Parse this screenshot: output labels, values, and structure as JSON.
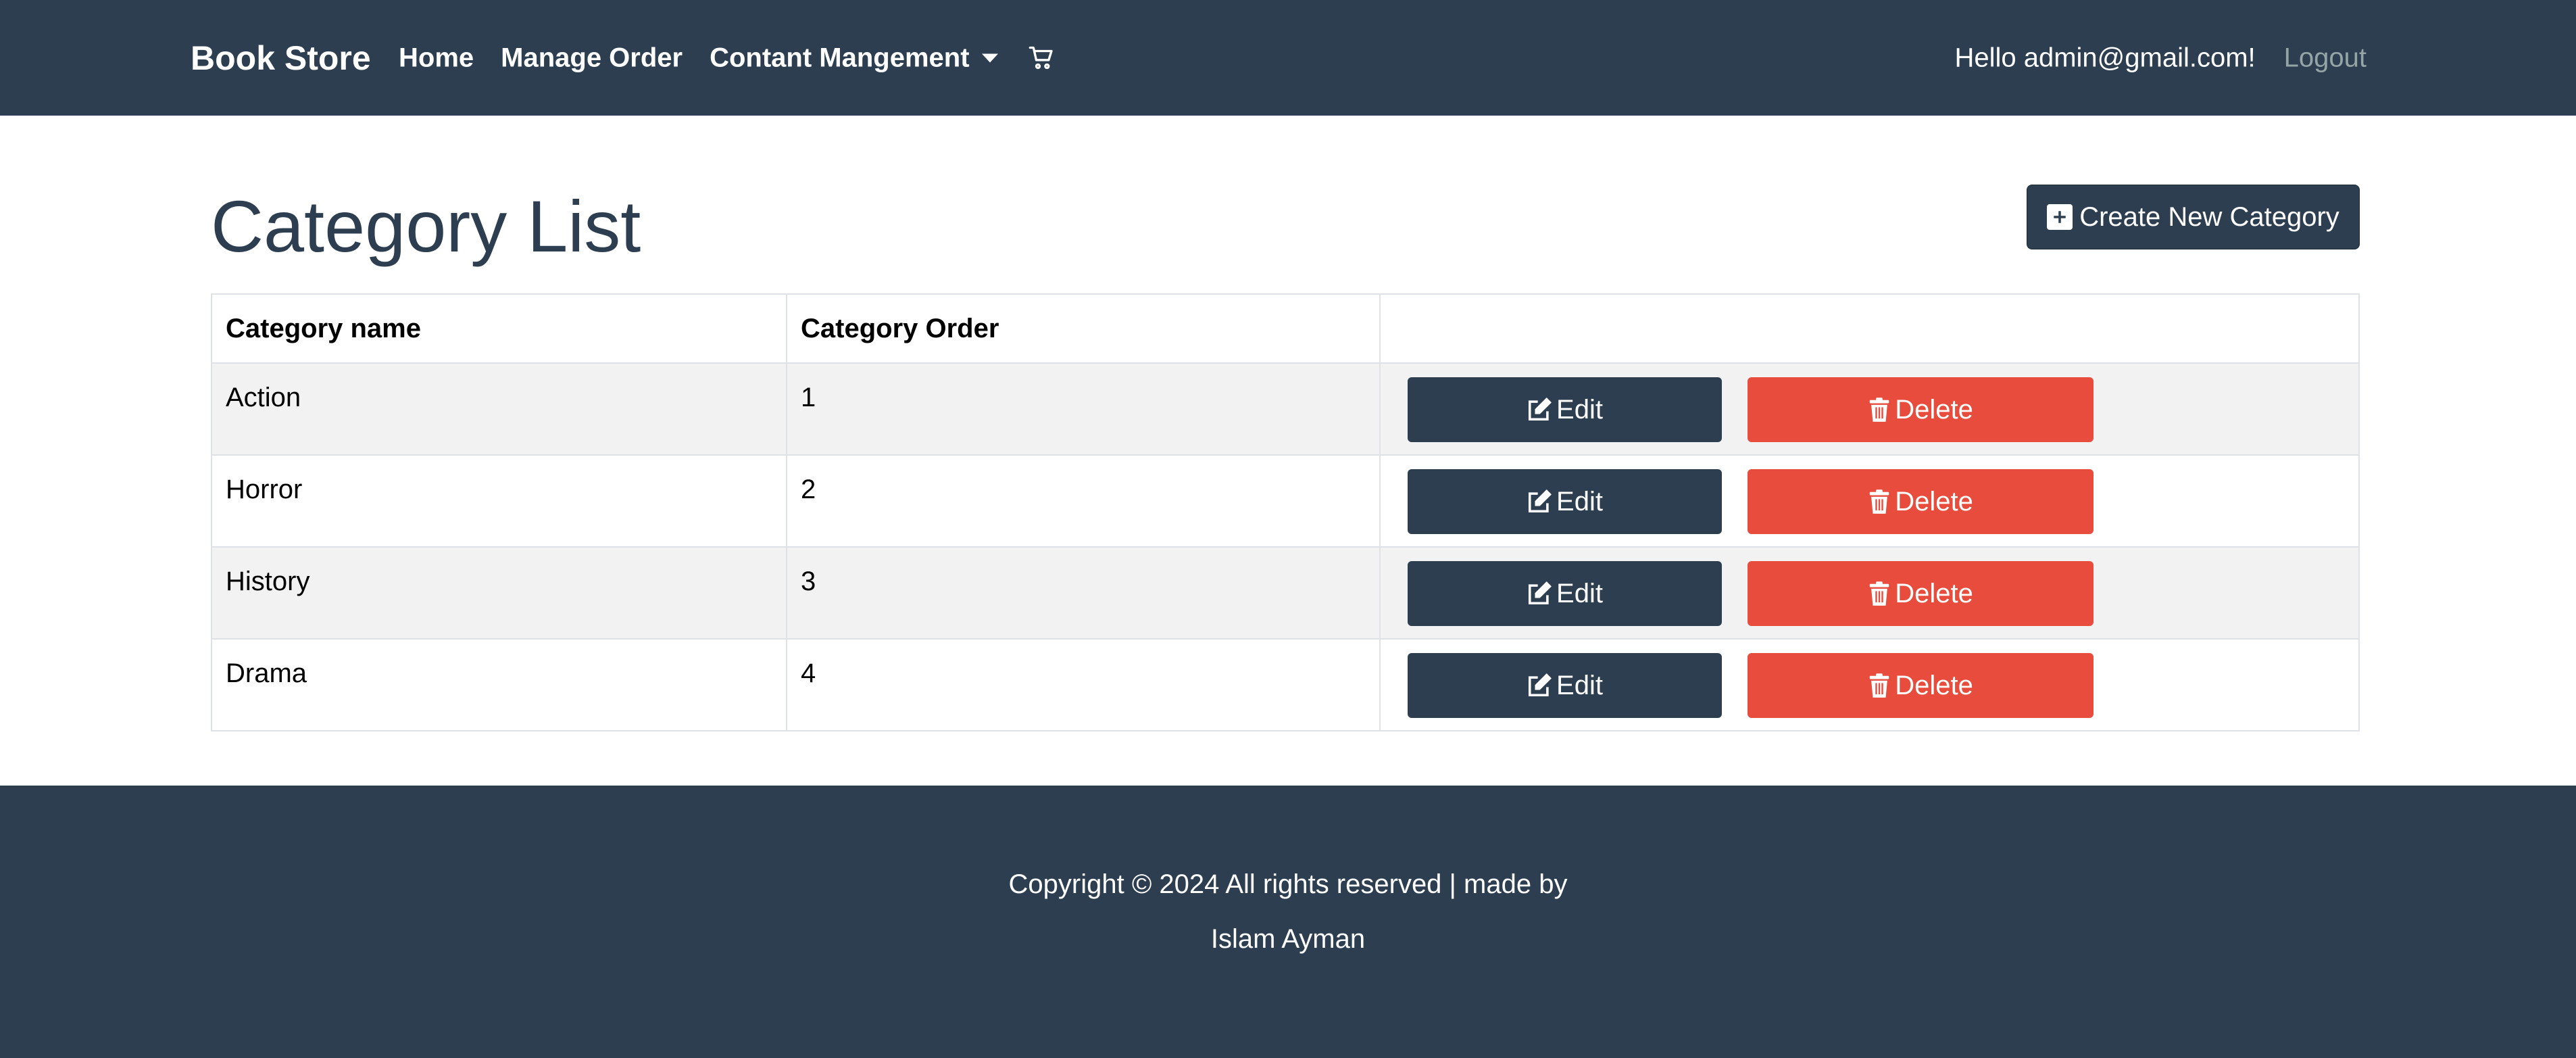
{
  "navbar": {
    "brand": "Book Store",
    "links": [
      {
        "label": "Home"
      },
      {
        "label": "Manage Order"
      },
      {
        "label": "Contant Mangement"
      }
    ],
    "cart_icon": "cart-icon",
    "greeting": "Hello admin@gmail.com!",
    "logout": "Logout"
  },
  "page": {
    "title": "Category List",
    "create_button": "Create New Category",
    "create_icon": "plus-square-icon"
  },
  "table": {
    "headers": [
      "Category name",
      "Category Order",
      ""
    ],
    "rows": [
      {
        "name": "Action",
        "order": "1"
      },
      {
        "name": "Horror",
        "order": "2"
      },
      {
        "name": "History",
        "order": "3"
      },
      {
        "name": "Drama",
        "order": "4"
      }
    ],
    "edit_label": "Edit",
    "delete_label": "Delete",
    "edit_icon": "pencil-square-icon",
    "delete_icon": "trash-icon"
  },
  "footer": {
    "line1": "Copyright © 2024 All rights reserved | made by",
    "line2": "Islam Ayman"
  },
  "colors": {
    "primary": "#2c3e50",
    "danger": "#e74c3c",
    "muted": "#95a5a6",
    "stripe": "#f2f2f2"
  }
}
